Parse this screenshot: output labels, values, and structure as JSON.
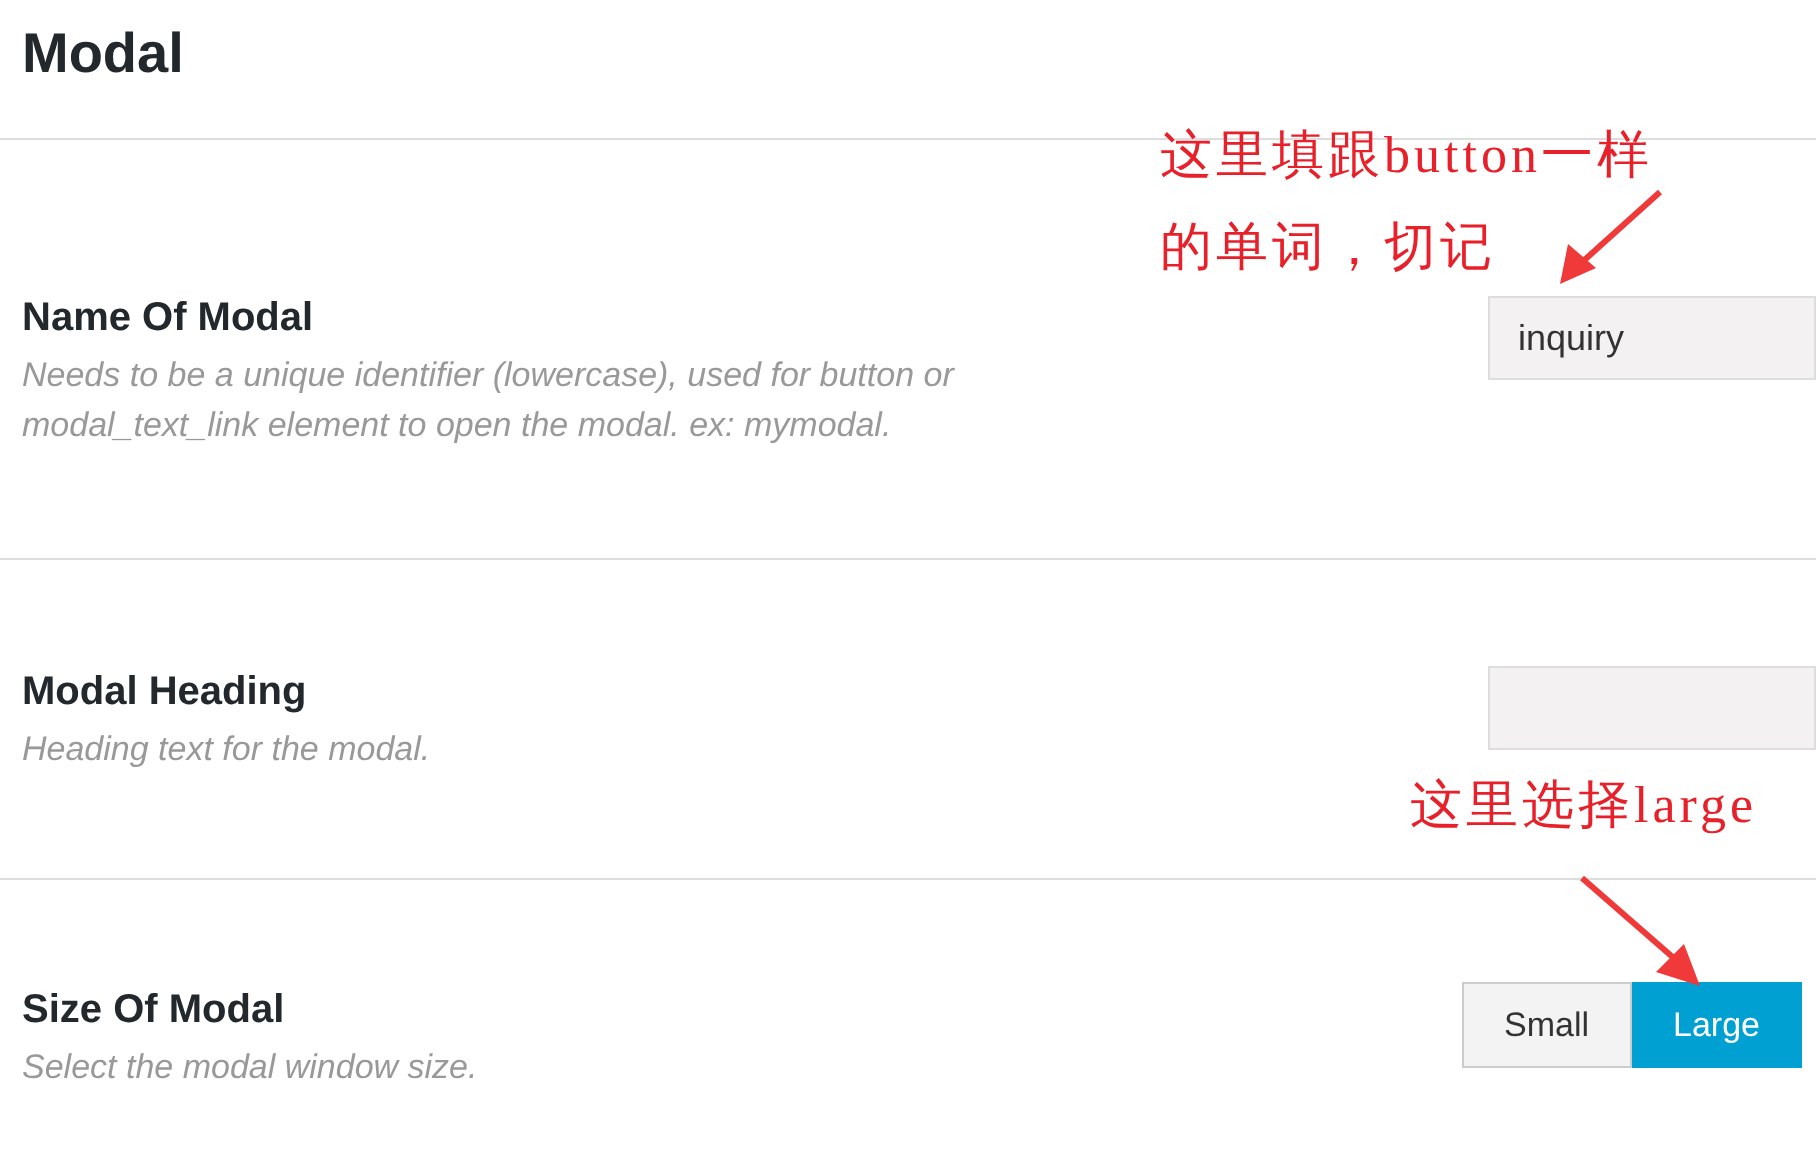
{
  "title": "Modal",
  "settings": [
    {
      "kind": "text",
      "label": "Name Of Modal",
      "description": "Needs to be a unique identifier (lowercase), used for button or modal_text_link element to open the modal. ex: mymodal.",
      "value": "inquiry"
    },
    {
      "kind": "text",
      "label": "Modal Heading",
      "description": "Heading text for the modal."
    },
    {
      "kind": "choice",
      "label": "Size Of Modal",
      "description": "Select the modal window size.",
      "options": [
        {
          "label": "Small",
          "selected": false
        },
        {
          "label": "Large",
          "selected": true
        }
      ]
    }
  ],
  "annotations": [
    {
      "lines": [
        "这里填跟button一样",
        "的单词，切记"
      ]
    },
    {
      "lines": [
        "这里选择large"
      ]
    }
  ]
}
